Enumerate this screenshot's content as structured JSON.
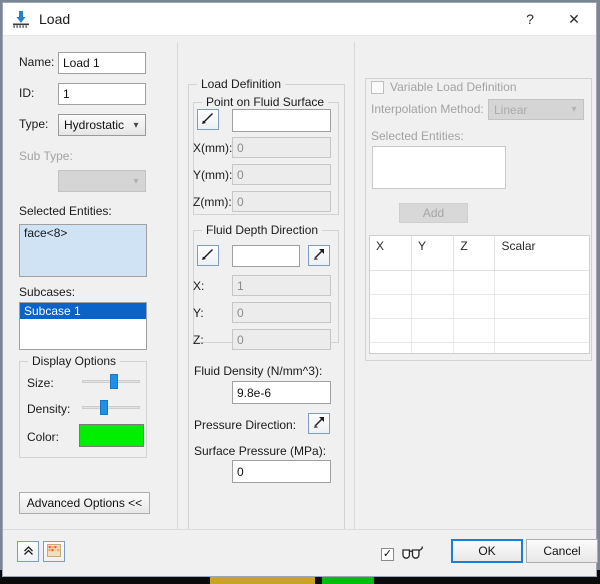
{
  "window": {
    "title": "Load",
    "icon": "load-icon",
    "help_label": "?",
    "close_label": "✕"
  },
  "left_panel": {
    "name_label": "Name:",
    "name_value": "Load 1",
    "id_label": "ID:",
    "id_value": "1",
    "type_label": "Type:",
    "type_value": "Hydrostatic Loa",
    "sub_type_label": "Sub Type:",
    "sub_type_value": "",
    "selected_entities_label": "Selected Entities:",
    "selected_entities": [
      "face<8>"
    ],
    "subcases_label": "Subcases:",
    "subcases": [
      "Subcase 1"
    ],
    "display_options": {
      "title": "Display Options",
      "size_label": "Size:",
      "size_value": 55,
      "density_label": "Density:",
      "density_value": 35,
      "color_label": "Color:",
      "color_value": "#00ee00"
    },
    "advanced_options_label": "Advanced Options <<"
  },
  "load_definition": {
    "title": "Load Definition",
    "point_on_fluid_surface": {
      "title": "Point on Fluid Surface",
      "picker_icon": "pick-line-icon",
      "entity_value": "",
      "x_label": "X(mm):",
      "x_value": "0",
      "y_label": "Y(mm):",
      "y_value": "0",
      "z_label": "Z(mm):",
      "z_value": "0"
    },
    "fluid_depth_direction": {
      "title": "Fluid Depth Direction",
      "picker_icon": "pick-line-icon",
      "entity_value": "",
      "flip_icon": "arrow-pick-icon",
      "x_label": "X:",
      "x_value": "1",
      "y_label": "Y:",
      "y_value": "0",
      "z_label": "Z:",
      "z_value": "0"
    },
    "fluid_density_label": "Fluid Density (N/mm^3):",
    "fluid_density_value": "9.8e-6",
    "pressure_direction_label": "Pressure Direction:",
    "pressure_direction_icon": "arrow-pick-icon",
    "surface_pressure_label": "Surface Pressure (MPa):",
    "surface_pressure_value": "0"
  },
  "variable_load": {
    "checkbox_label": "Variable Load Definition",
    "checkbox_checked": false,
    "interpolation_label": "Interpolation Method:",
    "interpolation_value": "Linear",
    "selected_entities_label": "Selected Entities:",
    "selected_entities_value": "",
    "add_label": "Add",
    "table": {
      "columns": [
        "X",
        "Y",
        "Z",
        "Scalar"
      ],
      "rows": [
        [
          "",
          "",
          "",
          ""
        ],
        [
          "",
          "",
          "",
          ""
        ],
        [
          "",
          "",
          "",
          ""
        ],
        [
          "",
          "",
          "",
          ""
        ],
        [
          "",
          "",
          "",
          ""
        ]
      ]
    }
  },
  "footer": {
    "collapse_icon": "collapse-up-icon",
    "table_icon": "color-table-icon",
    "preview_checkbox_checked": true,
    "preview_icon": "glasses-icon",
    "ok_label": "OK",
    "cancel_label": "Cancel"
  }
}
